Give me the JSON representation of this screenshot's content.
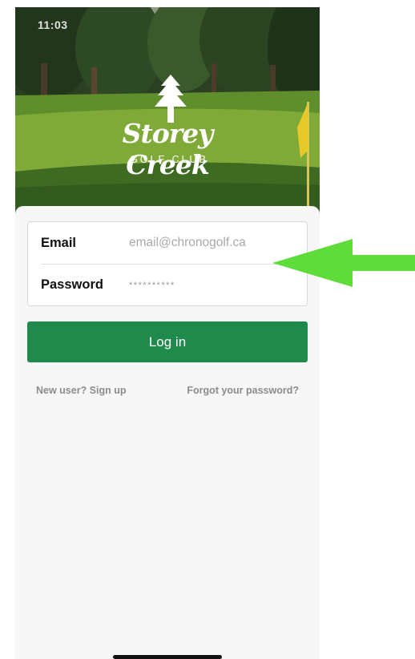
{
  "status_bar": {
    "time": "11:03"
  },
  "club": {
    "logo_name": "Storey Creek",
    "logo_subtitle": "GOLF CLUB"
  },
  "login_form": {
    "email_label": "Email",
    "email_placeholder": "email@chronogolf.ca",
    "password_label": "Password",
    "password_placeholder": "**********",
    "submit_label": "Log in",
    "signup_link": "New user? Sign up",
    "forgot_link": "Forgot your password?"
  },
  "colors": {
    "primary_button": "#1f8a4c",
    "annotation_arrow": "#5ddc3a",
    "background": "#f7f7f7"
  },
  "icons": {
    "annotation": "arrow-left-icon",
    "logo": "pine-tree-icon"
  }
}
